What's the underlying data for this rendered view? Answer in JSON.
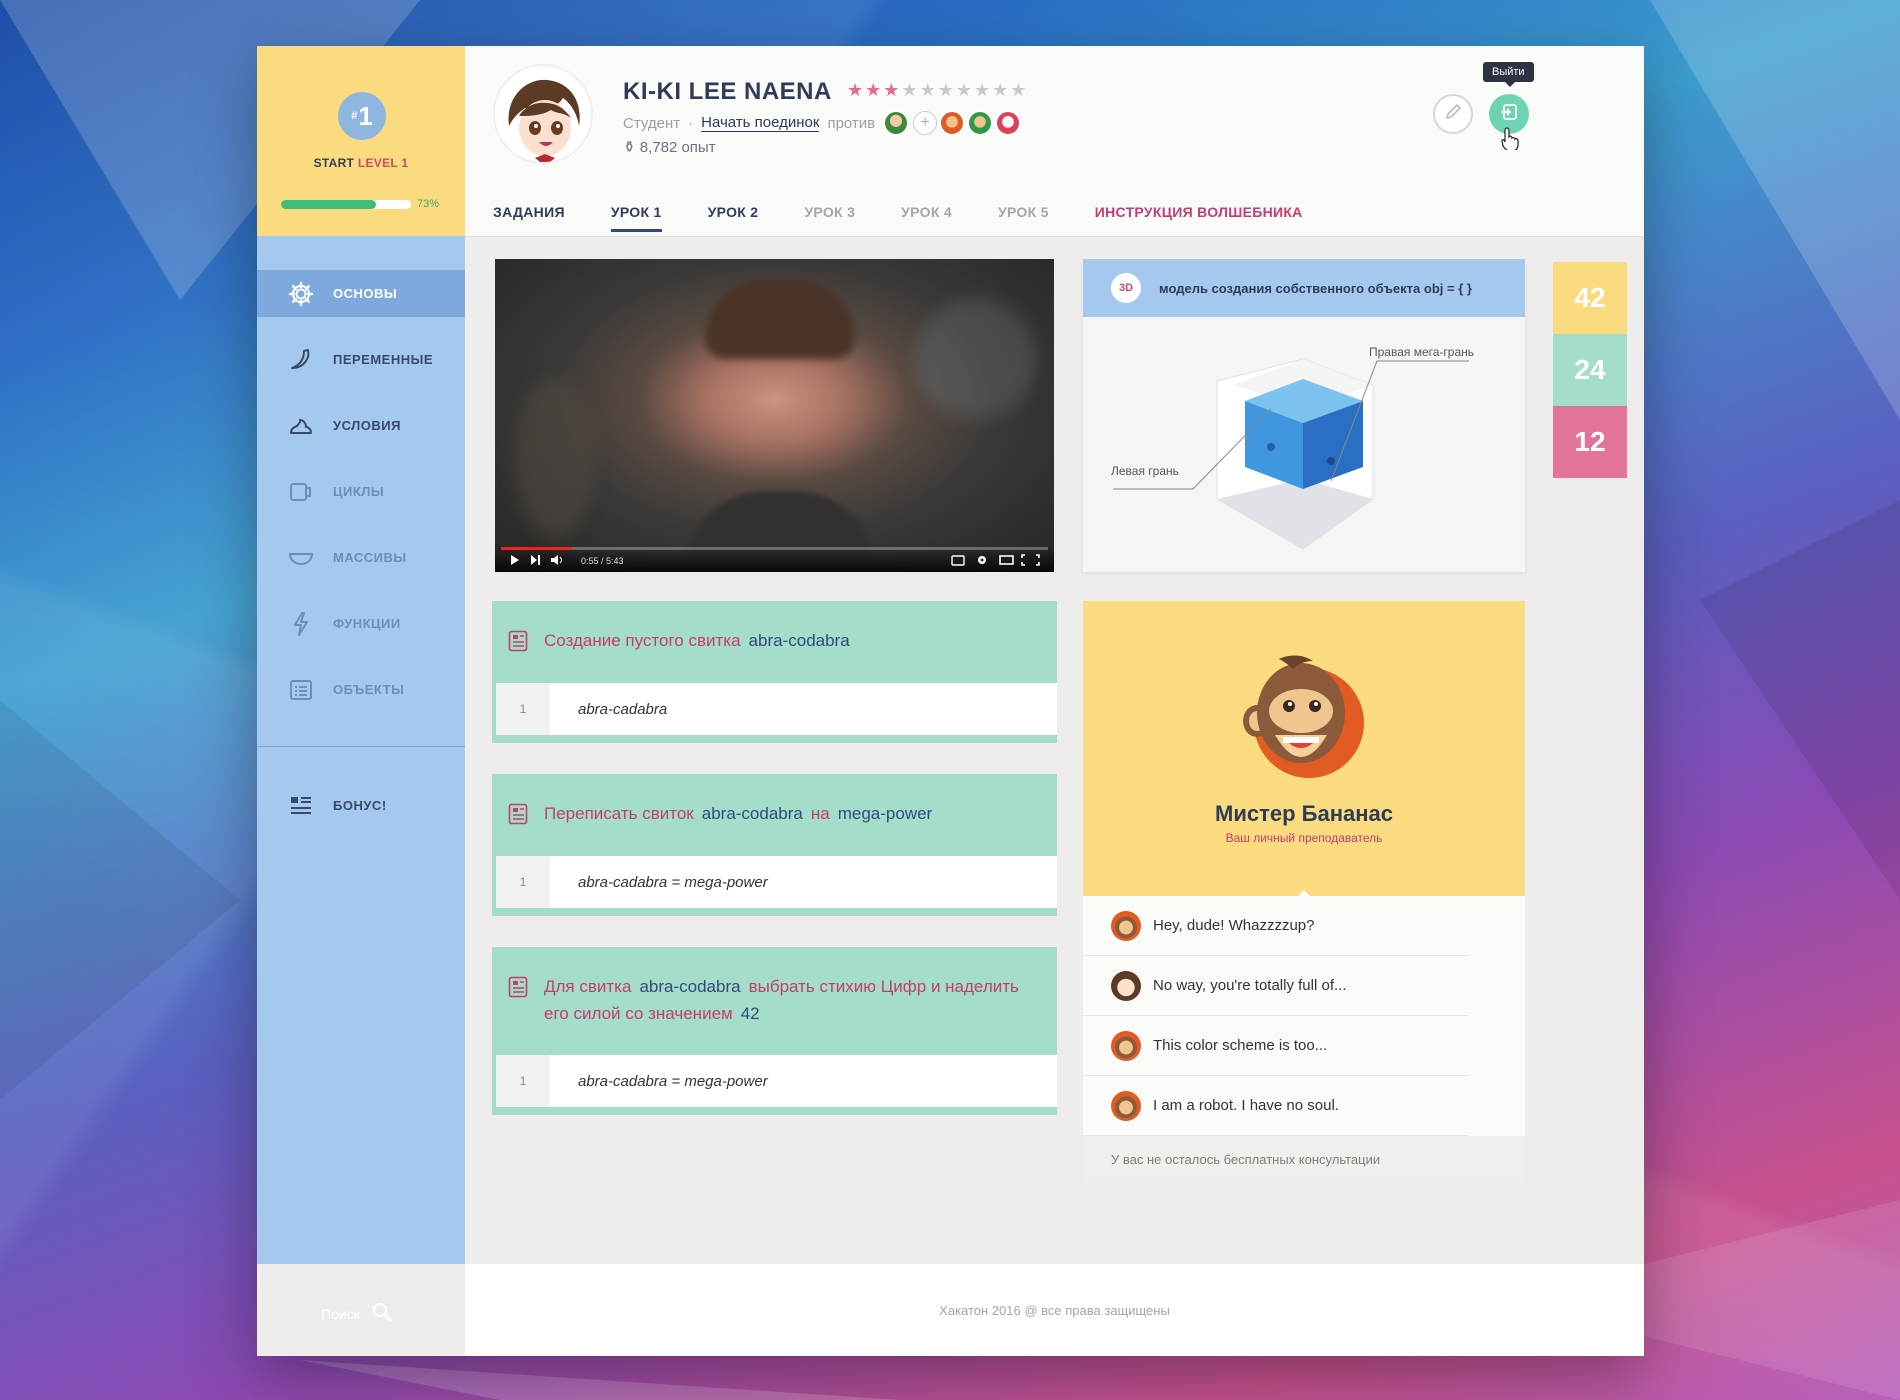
{
  "level": {
    "badge_prefix": "#",
    "badge_num": "1",
    "label_start": "START",
    "label_level": "LEVEL 1",
    "progress": 0.73,
    "progress_text": "73%"
  },
  "sidebar": {
    "items": [
      {
        "label": "ОСНОВЫ",
        "icon": "gear-icon",
        "active": true
      },
      {
        "label": "ПЕРЕМЕННЫЕ",
        "icon": "banana-icon"
      },
      {
        "label": "УСЛОВИЯ",
        "icon": "cream-icon"
      },
      {
        "label": "ЦИКЛЫ",
        "icon": "cup-icon"
      },
      {
        "label": "МАССИВЫ",
        "icon": "bowl-icon"
      },
      {
        "label": "ФУНКЦИИ",
        "icon": "lightning-icon"
      },
      {
        "label": "ОБЪЕКТЫ",
        "icon": "list-icon"
      }
    ],
    "bonus": "БОНУС!",
    "search": "Поиск"
  },
  "user": {
    "name": "KI-KI LEE NAENA",
    "rating": 3,
    "rating_max": 10,
    "role": "Студент",
    "dot": "·",
    "duel_link": "Начать поединок",
    "against": "против",
    "xp": "8,782 опыт",
    "plus": "+"
  },
  "header": {
    "exit_tooltip": "Выйти"
  },
  "tabs": [
    {
      "label": "ЗАДАНИЯ",
      "style": ""
    },
    {
      "label": "УРОК 1",
      "style": "active"
    },
    {
      "label": "УРОК 2",
      "style": ""
    },
    {
      "label": "УРОК 3",
      "style": "dim"
    },
    {
      "label": "УРОК 4",
      "style": "dim"
    },
    {
      "label": "УРОК 5",
      "style": "dim"
    },
    {
      "label": "ИНСТРУКЦИЯ ВОЛШЕБНИКА",
      "style": "pink"
    }
  ],
  "video": {
    "time": "0:55 / 5:43",
    "progress": 0.13
  },
  "model3d": {
    "tag": "3D",
    "title": "модель создания собственного объекта obj = { }",
    "right_label": "Правая мега-грань",
    "left_label": "Левая грань"
  },
  "scores": [
    "42",
    "24",
    "12"
  ],
  "tasks": [
    {
      "parts": [
        {
          "t": "Создание пустого свитка",
          "c": "pink"
        },
        {
          "t": "abra-codabra",
          "c": "blue"
        }
      ],
      "line": "1",
      "code": "abra-cadabra"
    },
    {
      "parts": [
        {
          "t": "Переписать свиток",
          "c": "pink"
        },
        {
          "t": "abra-codabra",
          "c": "blue"
        },
        {
          "t": "на",
          "c": "pink"
        },
        {
          "t": "mega-power",
          "c": "blue"
        }
      ],
      "line": "1",
      "code": "abra-cadabra = mega-power"
    },
    {
      "parts": [
        {
          "t": "Для свитка",
          "c": "pink"
        },
        {
          "t": "abra-codabra",
          "c": "blue"
        },
        {
          "t": "выбрать стихию Цифр и наделить его силой со значением",
          "c": "pink"
        },
        {
          "t": "42",
          "c": "blue"
        }
      ],
      "line": "1",
      "code": "abra-cadabra = mega-power"
    }
  ],
  "tutor": {
    "name": "Мистер Бананас",
    "role": "Ваш личный преподаватель"
  },
  "chat": [
    {
      "text": "Hey, dude! Whazzzzup?",
      "who": "monkey"
    },
    {
      "text": "No way, you're totally full of...",
      "who": "girl"
    },
    {
      "text": "This color scheme is too...",
      "who": "monkey"
    },
    {
      "text": "I am a robot. I have no soul.",
      "who": "monkey"
    }
  ],
  "no_consult": "У вас не осталось бесплатных консультации",
  "footer": "Хакатон 2016 @ все права защищены",
  "colors": {
    "sidebar": "#a4c8ee",
    "yellow": "#fadb80",
    "mint": "#a4ddc9",
    "pink": "#c43d72",
    "navy": "#2f3c57",
    "exit": "#6ed3b3",
    "score1": "#fadb80",
    "score2": "#a4ddc9",
    "score3": "#e2739a"
  }
}
